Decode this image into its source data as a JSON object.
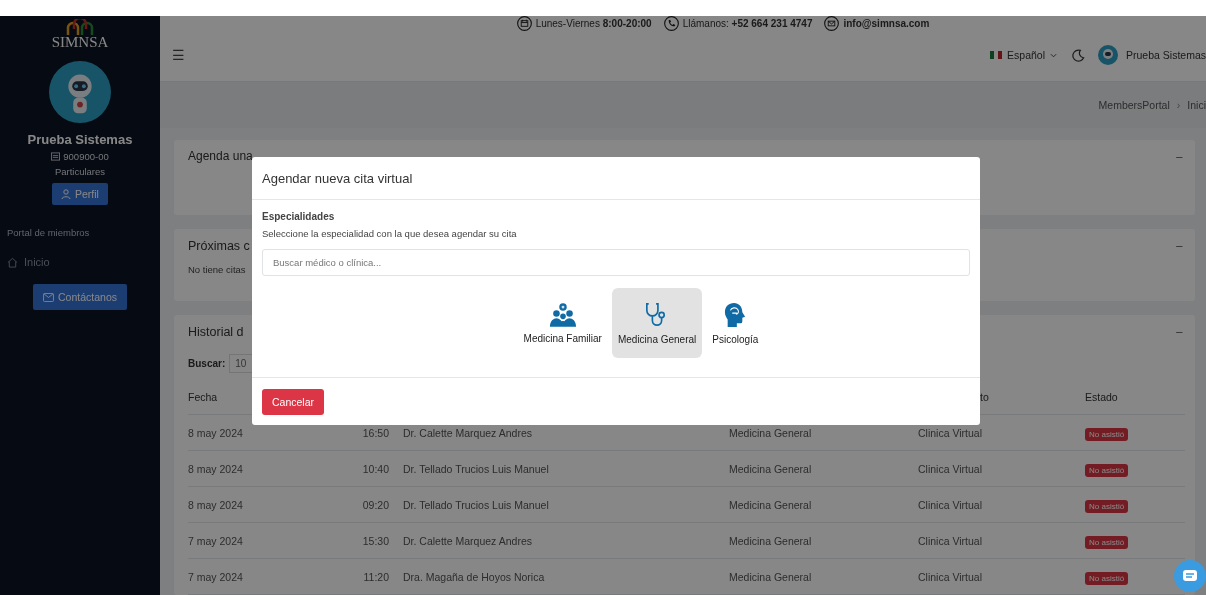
{
  "sidebar": {
    "logo": "SIMNSA",
    "user_name": "Prueba Sistemas",
    "member_id": "900900-00",
    "plan": "Particulares",
    "profile_button": "Perfil",
    "section_label": "Portal de miembros",
    "items": [
      {
        "label": "Inicio",
        "selected": false
      }
    ],
    "contact_button": "Contáctanos"
  },
  "info_bar": [
    {
      "kind": "calendar",
      "label": "Lunes-Viernes **8:00-20:00**"
    },
    {
      "kind": "phone",
      "label": "Llámanos: **+52 664 231 4747**"
    },
    {
      "kind": "mail",
      "label": "**info@simnsa.com**"
    }
  ],
  "header": {
    "menu_icon": "☰",
    "language": "Español",
    "user_name": "Prueba Sistemas"
  },
  "breadcrumb": [
    "MembersPortal",
    "›",
    "Inici"
  ],
  "cards": [
    {
      "title": "Agenda una",
      "collapse": "−"
    },
    {
      "title": "Próximas c",
      "text": "No tiene citas",
      "collapse": "−"
    },
    {
      "title": "Historial d",
      "collapse": "−"
    }
  ],
  "history": {
    "search_label": "Buscar:",
    "search_value": "10",
    "header": {
      "fecha": "Fecha",
      "column_5": "to",
      "estado": "Estado"
    },
    "rows": [
      {
        "date": "8 may 2024",
        "time": "16:50",
        "doctor": "Dr. Calette Marquez Andres",
        "specialty": "Medicina General",
        "clinic": "Clinica Virtual",
        "status": "No asistió"
      },
      {
        "date": "8 may 2024",
        "time": "10:40",
        "doctor": "Dr. Tellado Trucios Luis Manuel",
        "specialty": "Medicina General",
        "clinic": "Clinica Virtual",
        "status": "No asistió"
      },
      {
        "date": "8 may 2024",
        "time": "09:20",
        "doctor": "Dr. Tellado Trucios Luis Manuel",
        "specialty": "Medicina General",
        "clinic": "Clinica Virtual",
        "status": "No asistió"
      },
      {
        "date": "7 may 2024",
        "time": "15:30",
        "doctor": "Dr. Calette Marquez Andres",
        "specialty": "Medicina General",
        "clinic": "Clinica Virtual",
        "status": "No asistió"
      },
      {
        "date": "7 may 2024",
        "time": "11:20",
        "doctor": "Dra. Magaña de Hoyos Norica",
        "specialty": "Medicina General",
        "clinic": "Clinica Virtual",
        "status": "No asistió"
      }
    ]
  },
  "modal": {
    "title": "Agendar nueva cita virtual",
    "section_title": "Especialidades",
    "instruction": "Seleccione la especialidad con la que desea agendar su cita",
    "search": {
      "placeholder": "Buscar médico o clínica..."
    },
    "specialties": [
      {
        "kind": "family",
        "label": "Medicina Familiar",
        "selected": false
      },
      {
        "kind": "stethoscope",
        "label": "Medicina General",
        "selected": true
      },
      {
        "kind": "brain",
        "label": "Psicología",
        "selected": false
      }
    ],
    "cancel_button": "Cancelar"
  }
}
